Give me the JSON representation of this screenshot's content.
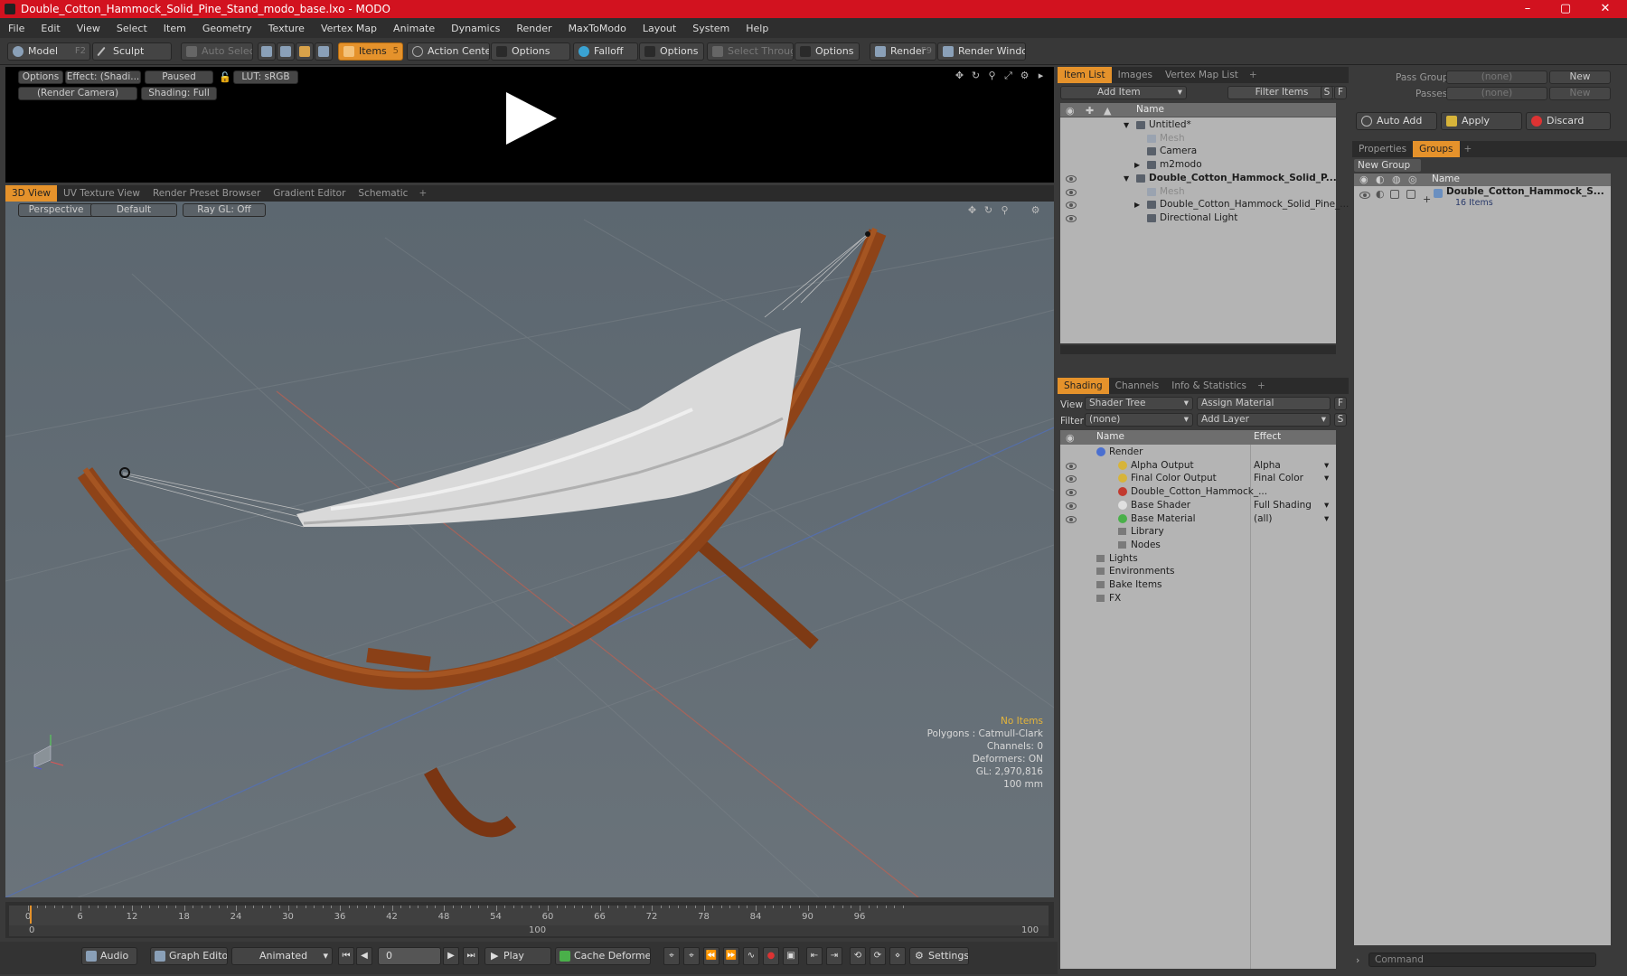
{
  "window": {
    "title": "Double_Cotton_Hammock_Solid_Pine_Stand_modo_base.lxo - MODO",
    "minimize": "–",
    "maximize": "▢",
    "close": "✕"
  },
  "menu": [
    "File",
    "Edit",
    "View",
    "Select",
    "Item",
    "Geometry",
    "Texture",
    "Vertex Map",
    "Animate",
    "Dynamics",
    "Render",
    "MaxToModo",
    "Layout",
    "System",
    "Help"
  ],
  "toolbar": {
    "model": "Model",
    "model_key": "F2",
    "sculpt": "Sculpt",
    "auto_select": "Auto Select",
    "items": "Items",
    "items_key": "5",
    "action_center": "Action Center",
    "options1": "Options",
    "falloff": "Falloff",
    "options2": "Options",
    "select_through": "Select Through",
    "options3": "Options",
    "render": "Render",
    "render_key": "F9",
    "render_window": "Render Window"
  },
  "preview": {
    "options": "Options",
    "effect": "Effect: (Shadi...",
    "paused": "Paused",
    "lut": "LUT: sRGB",
    "camera": "(Render Camera)",
    "shading": "Shading: Full"
  },
  "viewport_tabs": [
    "3D View",
    "UV Texture View",
    "Render Preset Browser",
    "Gradient Editor",
    "Schematic"
  ],
  "viewport": {
    "perspective": "Perspective",
    "default": "Default",
    "raygl": "Ray GL: Off"
  },
  "hud": {
    "no_items": "No Items",
    "polygons": "Polygons : Catmull-Clark",
    "channels": "Channels: 0",
    "deformers": "Deformers: ON",
    "gl": "GL: 2,970,816",
    "unit": "100 mm"
  },
  "timeline": {
    "ticks": [
      "0",
      "6",
      "12",
      "18",
      "24",
      "30",
      "36",
      "42",
      "48",
      "54",
      "60",
      "66",
      "72",
      "78",
      "84",
      "90",
      "96"
    ],
    "start": "0",
    "mid": "100",
    "end": "100"
  },
  "bottombar": {
    "audio": "Audio",
    "graph_editor": "Graph Editor",
    "animated": "Animated",
    "frame": "0",
    "play": "Play",
    "cache": "Cache Deformers",
    "settings": "Settings"
  },
  "itemlist": {
    "tabs": [
      "Item List",
      "Images",
      "Vertex Map List"
    ],
    "add_item": "Add Item",
    "filter_items": "Filter Items",
    "s": "S",
    "f": "F",
    "col_name": "Name",
    "rows": [
      {
        "label": "Untitled*",
        "indent": 0,
        "bold": false,
        "dim": false,
        "eye": false,
        "arrow": "▼"
      },
      {
        "label": "Mesh",
        "indent": 1,
        "bold": false,
        "dim": true,
        "eye": false,
        "arrow": ""
      },
      {
        "label": "Camera",
        "indent": 1,
        "bold": false,
        "dim": false,
        "eye": false,
        "arrow": ""
      },
      {
        "label": "m2modo",
        "indent": 1,
        "bold": false,
        "dim": false,
        "eye": false,
        "arrow": "▶"
      },
      {
        "label": "Double_Cotton_Hammock_Solid_P...",
        "indent": 0,
        "bold": true,
        "dim": false,
        "eye": true,
        "arrow": "▼"
      },
      {
        "label": "Mesh",
        "indent": 1,
        "bold": false,
        "dim": true,
        "eye": true,
        "arrow": ""
      },
      {
        "label": "Double_Cotton_Hammock_Solid_Pine_...",
        "indent": 1,
        "bold": false,
        "dim": false,
        "eye": true,
        "arrow": "▶"
      },
      {
        "label": "Directional Light",
        "indent": 1,
        "bold": false,
        "dim": false,
        "eye": true,
        "arrow": ""
      }
    ]
  },
  "shading": {
    "tabs": [
      "Shading",
      "Channels",
      "Info & Statistics"
    ],
    "view_label": "View",
    "view_value": "Shader Tree",
    "assign_material": "Assign Material",
    "filter_label": "Filter",
    "filter_value": "(none)",
    "add_layer": "Add Layer",
    "f": "F",
    "s": "S",
    "col_name": "Name",
    "col_effect": "Effect",
    "rows": [
      {
        "label": "Render",
        "effect": "",
        "indent": 0,
        "eye": false,
        "color": "#4a6fd0"
      },
      {
        "label": "Alpha Output",
        "effect": "Alpha",
        "indent": 1,
        "eye": true,
        "color": "#d7b43a"
      },
      {
        "label": "Final Color Output",
        "effect": "Final Color",
        "indent": 1,
        "eye": true,
        "color": "#d7b43a"
      },
      {
        "label": "Double_Cotton_Hammock_...",
        "effect": "",
        "indent": 1,
        "eye": true,
        "color": "#c23a2f"
      },
      {
        "label": "Base Shader",
        "effect": "Full Shading",
        "indent": 1,
        "eye": true,
        "color": "#e0e0e0"
      },
      {
        "label": "Base Material",
        "effect": "(all)",
        "indent": 1,
        "eye": true,
        "color": "#4ab04a"
      },
      {
        "label": "Library",
        "effect": "",
        "indent": 1,
        "eye": false,
        "color": ""
      },
      {
        "label": "Nodes",
        "effect": "",
        "indent": 1,
        "eye": false,
        "color": ""
      },
      {
        "label": "Lights",
        "effect": "",
        "indent": 0,
        "eye": false,
        "color": ""
      },
      {
        "label": "Environments",
        "effect": "",
        "indent": 0,
        "eye": false,
        "color": ""
      },
      {
        "label": "Bake Items",
        "effect": "",
        "indent": 0,
        "eye": false,
        "color": ""
      },
      {
        "label": "FX",
        "effect": "",
        "indent": 0,
        "eye": false,
        "color": ""
      }
    ]
  },
  "passes": {
    "pass_groups": "Pass Groups",
    "passes": "Passes",
    "none1": "(none)",
    "none2": "(none)",
    "new1": "New",
    "new2": "New",
    "auto_add": "Auto Add",
    "apply": "Apply",
    "discard": "Discard"
  },
  "groups": {
    "tabs": [
      "Properties",
      "Groups"
    ],
    "new_group": "New Group",
    "col_name": "Name",
    "item": "Double_Cotton_Hammock_S...",
    "count": "16 Items"
  },
  "command": {
    "placeholder": "Command"
  }
}
